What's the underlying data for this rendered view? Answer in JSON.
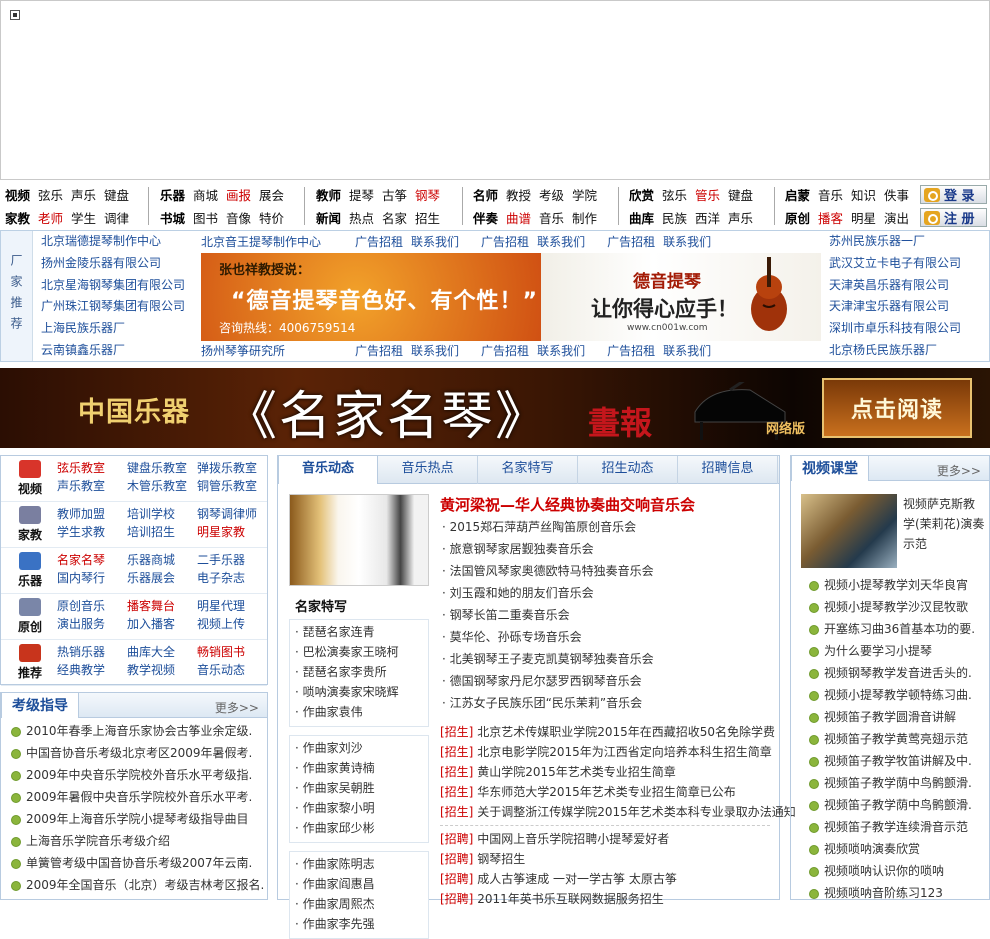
{
  "nav": {
    "g1": [
      [
        "视频",
        "弦乐",
        "声乐",
        "键盘"
      ],
      [
        "家教",
        "老师",
        "学生",
        "调律"
      ]
    ],
    "g2": [
      [
        "乐器",
        "商城",
        "画报",
        "展会"
      ],
      [
        "书城",
        "图书",
        "音像",
        "特价"
      ]
    ],
    "g3": [
      [
        "教师",
        "提琴",
        "古筝",
        "钢琴"
      ],
      [
        "新闻",
        "热点",
        "名家",
        "招生"
      ]
    ],
    "g4": [
      [
        "名师",
        "教授",
        "考级",
        "学院"
      ],
      [
        "伴奏",
        "曲谱",
        "音乐",
        "制作"
      ]
    ],
    "g5": [
      [
        "欣赏",
        "弦乐",
        "管乐",
        "键盘"
      ],
      [
        "曲库",
        "民族",
        "西洋",
        "声乐"
      ]
    ],
    "g6": [
      [
        "启蒙",
        "音乐",
        "知识",
        "佚事"
      ],
      [
        "原创",
        "播客",
        "明星",
        "演出"
      ]
    ],
    "login": "登 录",
    "register": "注 册"
  },
  "factory": {
    "label": "厂家推荐",
    "left": [
      "北京瑞德提琴制作中心",
      "扬州金陵乐器有限公司",
      "北京星海钢琴集团有限公司",
      "广州珠江钢琴集团有限公司",
      "上海民族乐器厂",
      "云南镇鑫乐器厂"
    ],
    "right": [
      "苏州民族乐器一厂",
      "武汉艾立卡电子有限公司",
      "天津英昌乐器有限公司",
      "天津津宝乐器有限公司",
      "深圳市卓乐科技有限公司",
      "北京杨氏民族乐器厂"
    ],
    "top_first": "北京音王提琴制作中心",
    "bottom_first": "扬州琴筝研究所",
    "ad": "广告招租",
    "contact": "联系我们",
    "banner": {
      "t1": "张也祥教授说：",
      "t2": "“德音提琴音色好、有个性！”",
      "t3": "咨询热线：4006759514",
      "t4": "德音提琴",
      "t5": "让你得心应手！",
      "t6": "www.cn001w.com"
    }
  },
  "bigbanner": {
    "a": "中国乐器",
    "b": "《名家名琴》",
    "c": "畫報",
    "d": "网络版",
    "btn": "点击阅读"
  },
  "categories": [
    {
      "title": "视频",
      "color": "#d8342a",
      "links": [
        [
          "弦乐教室",
          1
        ],
        [
          "键盘乐教室",
          0
        ],
        [
          "弹拨乐教室",
          0
        ],
        [
          "声乐教室",
          0
        ],
        [
          "木管乐教室",
          0
        ],
        [
          "铜管乐教室",
          0
        ]
      ]
    },
    {
      "title": "家教",
      "color": "#7a7fa0",
      "links": [
        [
          "教师加盟",
          0
        ],
        [
          "培训学校",
          0
        ],
        [
          "钢琴调律师",
          0
        ],
        [
          "学生求教",
          0
        ],
        [
          "培训招生",
          0
        ],
        [
          "明星家教",
          1
        ]
      ]
    },
    {
      "title": "乐器",
      "color": "#3a72c4",
      "links": [
        [
          "名家名琴",
          1
        ],
        [
          "乐器商城",
          0
        ],
        [
          "二手乐器",
          0
        ],
        [
          "国内琴行",
          0
        ],
        [
          "乐器展会",
          0
        ],
        [
          "电子杂志",
          0
        ]
      ]
    },
    {
      "title": "原创",
      "color": "#7a86a8",
      "links": [
        [
          "原创音乐",
          0
        ],
        [
          "播客舞台",
          1
        ],
        [
          "明星代理",
          0
        ],
        [
          "演出服务",
          0
        ],
        [
          "加入播客",
          0
        ],
        [
          "视频上传",
          0
        ]
      ]
    },
    {
      "title": "推荐",
      "color": "#c8341c",
      "links": [
        [
          "热销乐器",
          0
        ],
        [
          "曲库大全",
          0
        ],
        [
          "畅销图书",
          1
        ],
        [
          "经典教学",
          0
        ],
        [
          "教学视频",
          0
        ],
        [
          "音乐动态",
          0
        ]
      ]
    }
  ],
  "kaoji": {
    "title": "考级指导",
    "more": "更多>>",
    "items": [
      "2010年春季上海音乐家协会古筝业余定级.",
      "中国音协音乐考级北京考区2009年暑假考.",
      "2009年中央音乐学院校外音乐水平考级指.",
      "2009年暑假中央音乐学院校外音乐水平考.",
      "2009年上海音乐学院小提琴考级指导曲目",
      "上海音乐学院音乐考级介绍",
      "单簧管考级中国音协音乐考级2007年云南.",
      "2009年全国音乐（北京）考级吉林考区报名."
    ]
  },
  "tabs": [
    "音乐动态",
    "音乐热点",
    "名家特写",
    "招生动态",
    "招聘信息"
  ],
  "famous": {
    "title": "名家特写",
    "g1": [
      "琵琶名家连青",
      "巴松演奏家王晓柯",
      "琵琶名家李贵所",
      "唢呐演奏家宋晓辉",
      "作曲家袁伟"
    ],
    "g2": [
      "作曲家刘沙",
      "作曲家黄诗楠",
      "作曲家吴朝胜",
      "作曲家黎小明",
      "作曲家邱少彬"
    ],
    "g3": [
      "作曲家陈明志",
      "作曲家阎惠昌",
      "作曲家周熙杰",
      "作曲家李先强"
    ]
  },
  "headline": "黄河梁祝—华人经典协奏曲交响音乐会",
  "news": [
    "2015郑石萍葫芦丝陶笛原创音乐会",
    "旅意钢琴家居觐独奏音乐会",
    "法国管风琴家奥德欧特马特独奏音乐会",
    "刘玉霞和她的朋友们音乐会",
    "钢琴长笛二重奏音乐会",
    "莫华伦、孙砾专场音乐会",
    "北美钢琴王子麦克凯莫钢琴独奏音乐会",
    "德国钢琴家丹尼尔瑟罗西钢琴音乐会",
    "江苏女子民族乐团“民乐茉莉”音乐会"
  ],
  "recruit": {
    "tag1": "[招生]",
    "items1": [
      "北京艺术传媒职业学院2015年在西藏招收50名免除学费",
      "北京电影学院2015年为江西省定向培养本科生招生简章",
      "黄山学院2015年艺术类专业招生简章",
      "华东师范大学2015年艺术类专业招生简章已公布",
      "关于调整浙江传媒学院2015年艺术类本科专业录取办法通知"
    ],
    "tag2": "[招聘]",
    "items2": [
      "中国网上音乐学院招聘小提琴爱好者",
      "钢琴招生",
      "成人古筝速成 一对一学古筝 太原古筝",
      "2011年英书乐互联网数据服务招生"
    ]
  },
  "video": {
    "title": "视频课堂",
    "more": "更多>>",
    "desc": "视频萨克斯教学(茉莉花)演奏示范",
    "items": [
      "视频小提琴教学刘天华良宵",
      "视频小提琴教学沙汉昆牧歌",
      "开塞练习曲36首基本功的要.",
      "为什么要学习小提琴",
      "视频钢琴教学发音进舌头的.",
      "视频小提琴教学顿特练习曲.",
      "视频笛子教学圆滑音讲解",
      "视频笛子教学黄莺亮翅示范",
      "视频笛子教学牧笛讲解及中.",
      "视频笛子教学荫中鸟鹘颤滑.",
      "视频笛子教学荫中鸟鹘颤滑.",
      "视频笛子教学连续滑音示范",
      "视频唢呐演奏欣赏",
      "视频唢呐认识你的唢呐",
      "视频唢呐音阶练习123"
    ]
  }
}
